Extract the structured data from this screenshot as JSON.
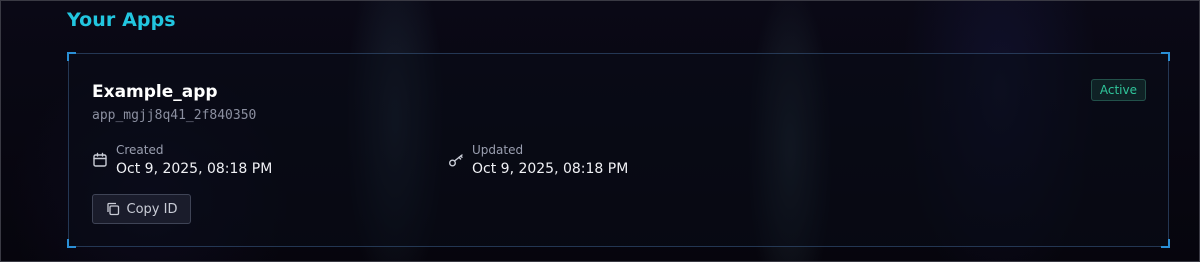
{
  "section": {
    "title": "Your Apps"
  },
  "app": {
    "name": "Example_app",
    "id": "app_mgjj8q41_2f840350",
    "status": "Active",
    "created": {
      "label": "Created",
      "value": "Oct 9, 2025, 08:18 PM",
      "icon": "calendar-icon"
    },
    "updated": {
      "label": "Updated",
      "value": "Oct 9, 2025, 08:18 PM",
      "icon": "key-icon"
    },
    "copy_button": {
      "label": "Copy ID",
      "icon": "copy-icon"
    }
  },
  "colors": {
    "accent": "#22c6e0",
    "status": "#2fc59a",
    "corner": "#2a8fd6"
  }
}
